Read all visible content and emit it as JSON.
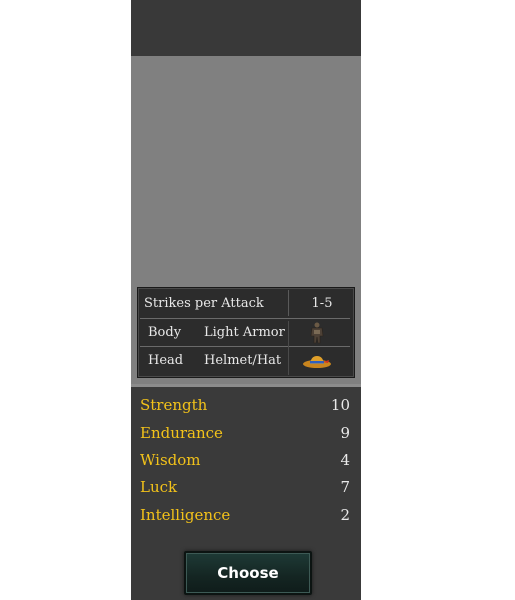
{
  "equipment": {
    "strikes": {
      "label": "Strikes per Attack",
      "value": "1-5"
    },
    "body": {
      "label": "Body",
      "type": "Light Armor",
      "icon": "light-armor-icon"
    },
    "head": {
      "label": "Head",
      "type": "Helmet/Hat",
      "icon": "hat-icon"
    }
  },
  "stats": [
    {
      "name": "Strength",
      "value": "10"
    },
    {
      "name": "Endurance",
      "value": "9"
    },
    {
      "name": "Wisdom",
      "value": "4"
    },
    {
      "name": "Luck",
      "value": "7"
    },
    {
      "name": "Intelligence",
      "value": "2"
    }
  ],
  "actions": {
    "choose_label": "Choose"
  },
  "colors": {
    "stat_name": "#f2c21a",
    "panel_bg": "#3a3a3a",
    "portrait_bg": "#808080"
  }
}
